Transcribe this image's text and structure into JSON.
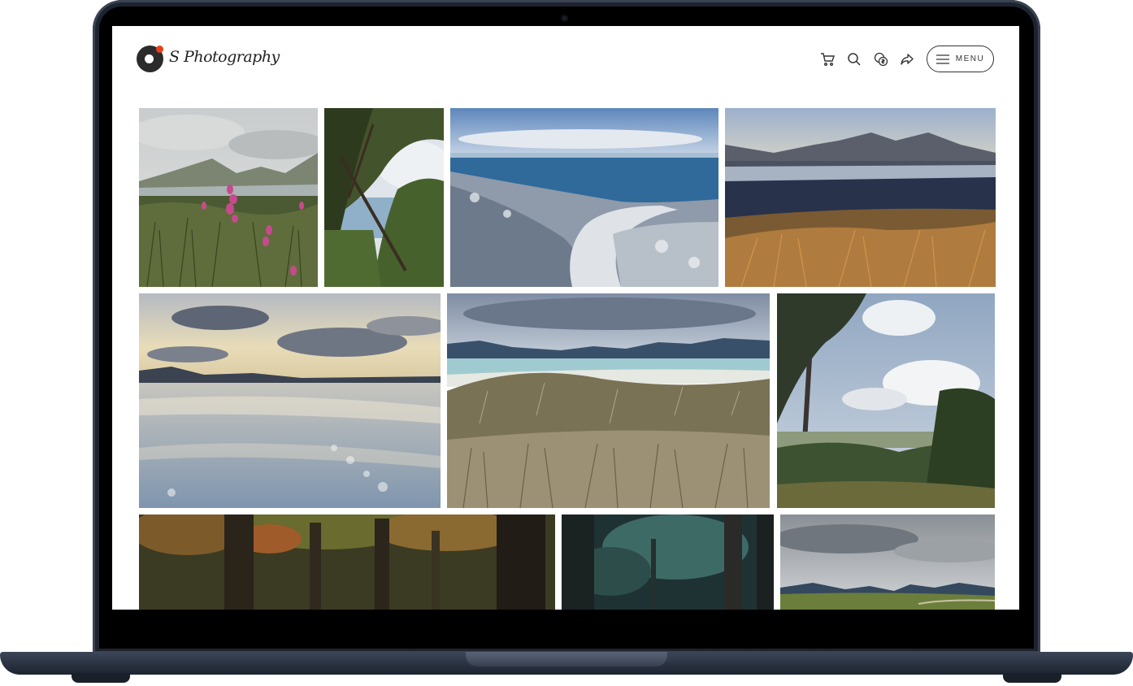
{
  "site": {
    "brand": "S Photography",
    "menu_label": "MENU"
  },
  "header_icons": [
    "cart-icon",
    "search-icon",
    "currency-icon",
    "share-icon",
    "hamburger-icon"
  ],
  "gallery": {
    "photos": [
      {
        "name": "photo-foxgloves-mountain-lake",
        "subject": "foxgloves by mountain lake"
      },
      {
        "name": "photo-trees-coast",
        "subject": "trees framing coast"
      },
      {
        "name": "photo-coastal-path",
        "subject": "frosty path to sea"
      },
      {
        "name": "photo-tidal-flats-mountains",
        "subject": "tidal flats and mountains"
      },
      {
        "name": "photo-beach-sunset",
        "subject": "wet beach at sunset"
      },
      {
        "name": "photo-dunes-beach",
        "subject": "grassy dunes and beach"
      },
      {
        "name": "photo-eucalyptus-valley",
        "subject": "eucalyptus over valley"
      },
      {
        "name": "photo-autumn-forest",
        "subject": "autumn forest"
      },
      {
        "name": "photo-pine-forest",
        "subject": "dark pine forest"
      },
      {
        "name": "photo-cloudy-moor",
        "subject": "cloudy moorland"
      }
    ]
  }
}
